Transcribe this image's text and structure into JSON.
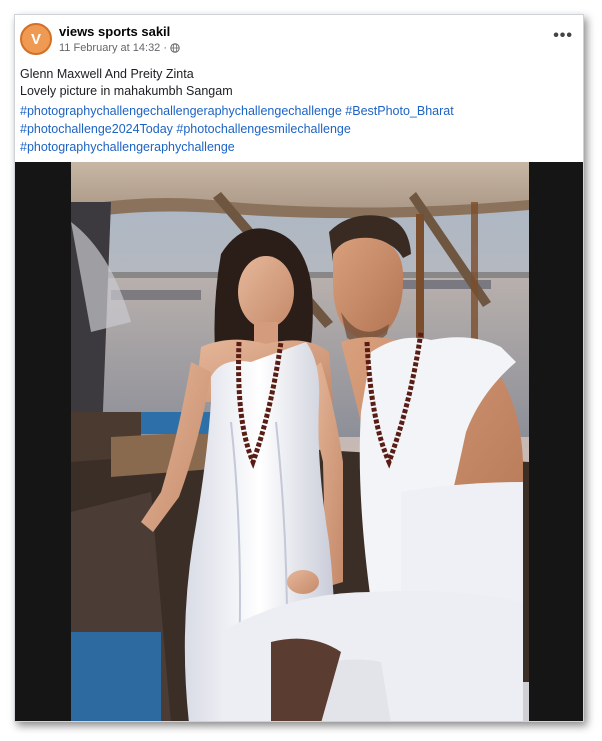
{
  "post": {
    "author": "views sports sakil",
    "avatar_letter": "V",
    "timestamp": "11 February at 14:32",
    "separator": "·",
    "audience_icon": "globe-icon",
    "more_icon": "more-options-icon",
    "more_label": "•••",
    "text_line1": "Glenn Maxwell And Preity Zinta",
    "text_line2": "Lovely picture in mahakumbh Sangam",
    "hashtags": [
      "#photographychallengechallengeraphychallengechallenge",
      "#BestPhoto_Bharat",
      "#photochallenge2024Today",
      "#photochallengesmilechallenge",
      "#photographychallengeraphychallenge"
    ]
  },
  "photo": {
    "subject": "couple-on-boat-photo"
  },
  "colors": {
    "link": "#1d63c4",
    "avatar_bg": "#ef9a52",
    "author_text": "#050505",
    "meta_text": "#65676b",
    "frame_bg": "#151515"
  }
}
